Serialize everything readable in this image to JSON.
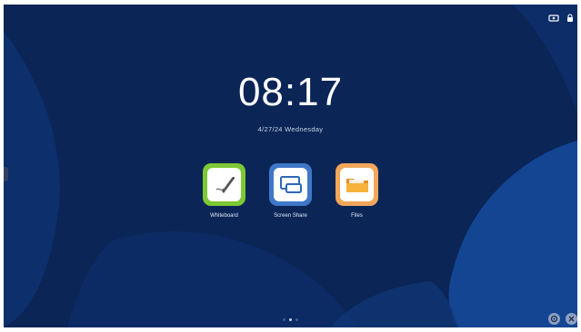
{
  "clock": {
    "time": "08:17",
    "date": "4/27/24  Wednesday"
  },
  "apps": [
    {
      "label": "Whiteboard",
      "icon": "whiteboard-pen-icon",
      "color": "#7cc934"
    },
    {
      "label": "Screen Share",
      "icon": "screen-share-icon",
      "color": "#3f78c8"
    },
    {
      "label": "Files",
      "icon": "folder-icon",
      "color": "#f2a65a"
    }
  ],
  "status": {
    "icons": [
      "network-icon",
      "lock-icon"
    ]
  },
  "pager": {
    "pages": 3,
    "current": 2
  },
  "colors": {
    "background": "#0a2556",
    "wave_light": "#134592",
    "wave_mid": "#0e3170"
  }
}
